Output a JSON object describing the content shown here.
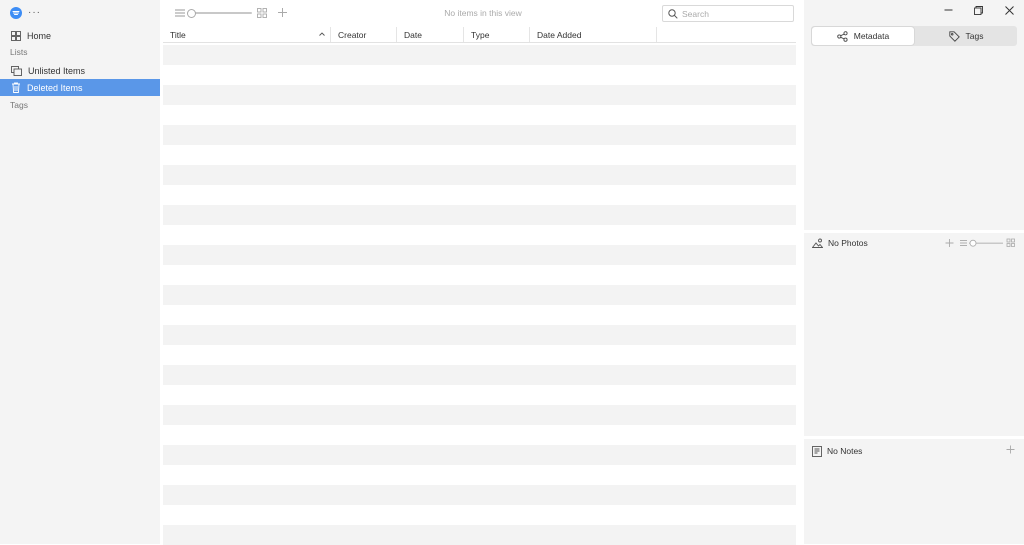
{
  "sidebar": {
    "more_label": "···",
    "home_label": "Home",
    "lists_heading": "Lists",
    "items": [
      {
        "label": "Unlisted Items"
      },
      {
        "label": "Deleted Items"
      }
    ],
    "tags_heading": "Tags"
  },
  "toolbar": {
    "status_text": "No items in this view",
    "search_placeholder": "Search"
  },
  "table": {
    "columns": [
      "Title",
      "Creator",
      "Date",
      "Type",
      "Date Added"
    ]
  },
  "inspector": {
    "tabs": [
      "Metadata",
      "Tags"
    ],
    "photos_label": "No Photos",
    "notes_label": "No Notes"
  },
  "colors": {
    "accent": "#5a97e8",
    "logo": "#3d8df5",
    "sidebar_bg": "#f4f4f4",
    "stripe": "#f3f3f3"
  }
}
